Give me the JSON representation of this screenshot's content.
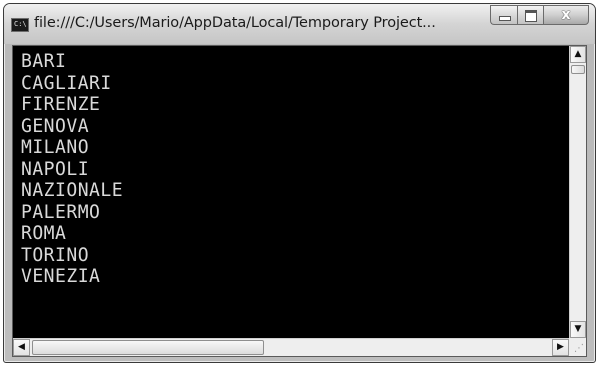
{
  "window": {
    "title": "file:///C:/Users/Mario/AppData/Local/Temporary Project...",
    "app_icon_text": "C:\\",
    "icon": "console-icon",
    "buttons": {
      "minimize_icon": "minimize-icon",
      "maximize_icon": "maximize-icon",
      "close_glyph": "x",
      "close_icon": "close-icon"
    }
  },
  "console": {
    "background": "#000000",
    "text_color": "#d9d9d9",
    "lines": [
      "BARI",
      "CAGLIARI",
      "FIRENZE",
      "GENOVA",
      "MILANO",
      "NAPOLI",
      "NAZIONALE",
      "PALERMO",
      "ROMA",
      "TORINO",
      "VENEZIA"
    ]
  },
  "scrollbars": {
    "up_arrow": "▲",
    "down_arrow": "▼",
    "left_arrow": "◀",
    "right_arrow": "▶",
    "grip": "⋰"
  }
}
